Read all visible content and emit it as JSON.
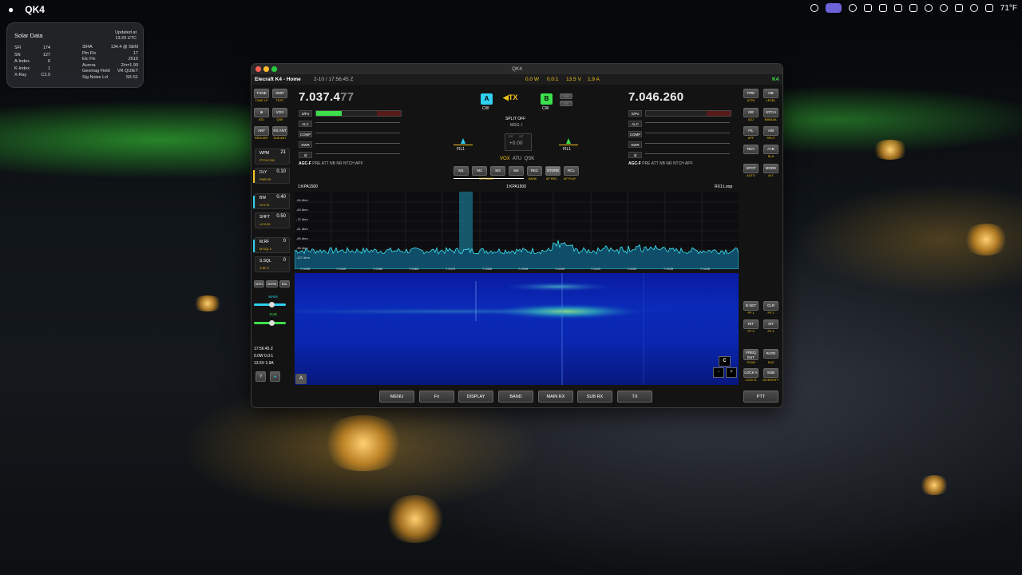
{
  "menubar": {
    "app": "QK4",
    "weather": "71°F"
  },
  "solar": {
    "title": "Solar Data",
    "updated_line1": "Updated at",
    "updated_line2": "13:29 UTC",
    "left": [
      [
        "SFI",
        "174"
      ],
      [
        "SN",
        "127"
      ],
      [
        "A-Index",
        "6"
      ],
      [
        "K-Index",
        "1"
      ],
      [
        "X-Ray",
        "C2.9"
      ]
    ],
    "right": [
      [
        "304A",
        "134.4 @ SEM"
      ],
      [
        "Ptn Flx",
        "17"
      ],
      [
        "Elc Flx",
        "2510"
      ],
      [
        "Aurora",
        "2/n=1.99"
      ],
      [
        "Geomag Field",
        "VR QUIET"
      ],
      [
        "Sig Noise Lvl",
        "S0-S1"
      ]
    ]
  },
  "window": {
    "title": "QK4",
    "status_name": "Elecraft K4 - Home",
    "status_date": "2-10 / 17:56:45 Z",
    "status_power": "0.0 W",
    "status_swr": "0.0:1",
    "status_volt": "13.5 V",
    "status_amp": "1.9 A",
    "status_model": "K4"
  },
  "left_buttons": {
    "tune": "TUNE",
    "tune_sub": "TUNE LP",
    "xmit": "XMIT",
    "xmit_sub": "TEST",
    "atu_sub": "ATU",
    "vox": "VOX",
    "vox_sub": "QSK",
    "ant": "ANT",
    "ant_sub": "REM ANT",
    "rxant": "RX ANT",
    "rxant_sub": "SUB ANT"
  },
  "knobs": [
    {
      "label": "WPM",
      "value": "21",
      "sub": "PTCH 0.50"
    },
    {
      "label": "DLY",
      "value": "0.10",
      "sub": "PWR 95"
    },
    {
      "label": "BW",
      "value": "0.40",
      "sub": "HI 0.70"
    },
    {
      "label": "SHFT",
      "value": "0.50",
      "sub": "LO 0.30"
    },
    {
      "label": "M.RF",
      "value": "0",
      "sub": "M.SQL 0"
    },
    {
      "label": "S.SQL",
      "value": "0",
      "sub": "S.RF 0"
    }
  ],
  "mon": {
    "mon": "MON",
    "norm": "NORM",
    "bal": "BAL",
    "main": "MAIN",
    "sub": "SUB"
  },
  "readout": {
    "time": "17:56:45 Z",
    "pwr": "0.0W 0.0:1",
    "volt": "13.5V 1.9A"
  },
  "vfo_a": {
    "freq_main": "7.037.4",
    "freq_dim": "77",
    "agc": "AGC-F",
    "agc_rest": "PRE ATT NB NR NTCH APF"
  },
  "vfo_b": {
    "freq_main": "7.046.2",
    "freq_dim": "60",
    "agc": "AGC-F",
    "agc_rest": "PRE ATT NB NR NTCH APF"
  },
  "meters": [
    "S/Po",
    "ALC",
    "COMP",
    "SWR",
    "Id"
  ],
  "center": {
    "a_badge": "A",
    "a_mode": "CW",
    "tx": "TX",
    "b_badge": "B",
    "b_mode": "CW",
    "sub": "SUB",
    "div": "DIV",
    "split": "SPLIT OFF",
    "msg": "MSG: I",
    "rit": "RIT",
    "xit": "XIT",
    "offset": "+0.00",
    "fil_a": "FIL1",
    "fil_b": "FIL1",
    "vox": "VOX",
    "atu": "ATU",
    "qsk": "QSK",
    "mem": [
      "M1",
      "M2",
      "M3",
      "M4",
      "REC",
      "STORE",
      "RCL"
    ],
    "mem_sub": {
      "message": "MESSAGE",
      "bank": "BANK",
      "afrec": "AF REC",
      "afplay": "AF PLAY"
    }
  },
  "right_buttons": {
    "pre": "PRE",
    "pre_sub": "ATTN",
    "nb": "NB",
    "nb_sub": "LEVEL",
    "nr": "NR",
    "nr_sub": "ADJ",
    "ntch": "NTCH",
    "ntch_sub": "MANUAL",
    "fil": "FIL",
    "fil_sub": "APF",
    "ab": "A/B",
    "ab_sub": "SPLIT",
    "rev": "REV",
    "rev_sub": "",
    "atob": "A>B",
    "atob_sub": "B>A",
    "spot": "SPOT",
    "spot_sub": "AUTO",
    "mode": "MODE",
    "mode_sub": "ALT",
    "bset": "B SET",
    "bset_sub": "PF 1",
    "clr": "CLR",
    "clr_sub": "PF 2",
    "rit": "RIT",
    "rit_sub": "PF 3",
    "xit": "XIT",
    "xit_sub": "PF 4",
    "freqent": "FREQ ENT",
    "freqent_sub": "SCAN",
    "rate": "RATE",
    "rate_sub": "KHZ",
    "locka": "LOCK A",
    "locka_sub": "LOCK B",
    "sub": "SUB",
    "sub_sub": "DIVERSITY"
  },
  "spectrum": {
    "left_label": "1:KPA1500",
    "center_label": "1:KPA1500",
    "right_label": "RX1:Loop",
    "dbm": [
      "-54 dbm",
      "-63 dbm",
      "-72 dbm",
      "-81 dbm",
      "-89 dbm",
      "-98 dbm",
      "-107 dbm"
    ],
    "ticks": [
      "7.0335",
      "7.0345",
      "7.0355",
      "7.0365",
      "7.0375",
      "7.0385",
      "7.0395",
      "7.0405",
      "7.0415",
      "7.0425",
      "7.0435",
      "7.0445"
    ],
    "corner_a": "A",
    "corner_c": "C",
    "minus": "-",
    "plus": "+"
  },
  "bottom": [
    "MENU",
    "Fn",
    "DISPLAY",
    "BAND",
    "MAIN RX",
    "SUB RX",
    "TX"
  ],
  "ptt": "PTT"
}
